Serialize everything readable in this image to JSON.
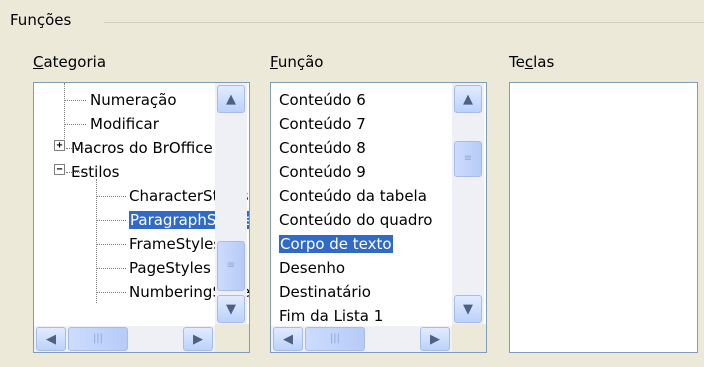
{
  "group": {
    "title": "Funções"
  },
  "columns": {
    "category": {
      "label_mnemonic": "C",
      "label_rest": "ategoria"
    },
    "function": {
      "label_mnemonic": "F",
      "label_rest": "unção"
    },
    "keys": {
      "label_pre": "Te",
      "label_mnemonic": "c",
      "label_rest": "las"
    }
  },
  "category_tree": [
    {
      "label": "Numeração",
      "level": 1
    },
    {
      "label": "Modificar",
      "level": 1
    },
    {
      "label": "Macros do BrOffice",
      "level": 0,
      "expander": "+"
    },
    {
      "label": "Estilos",
      "level": 0,
      "expander": "−"
    },
    {
      "label": "CharacterStyles",
      "level": 1
    },
    {
      "label": "ParagraphStyles",
      "level": 1,
      "selected": true
    },
    {
      "label": "FrameStyles",
      "level": 1
    },
    {
      "label": "PageStyles",
      "level": 1
    },
    {
      "label": "NumberingStyles",
      "level": 1
    }
  ],
  "function_list": [
    {
      "label": "Conteúdo 6"
    },
    {
      "label": "Conteúdo 7"
    },
    {
      "label": "Conteúdo 8"
    },
    {
      "label": "Conteúdo 9"
    },
    {
      "label": "Conteúdo da tabela"
    },
    {
      "label": "Conteúdo do quadro"
    },
    {
      "label": "Corpo de texto",
      "selected": true
    },
    {
      "label": "Desenho"
    },
    {
      "label": "Destinatário"
    },
    {
      "label": "Fim da Lista 1"
    }
  ],
  "keys_list": [],
  "icons": {
    "up": "▲",
    "down": "▼",
    "left": "◀",
    "right": "▶",
    "plus": "+",
    "minus": "−",
    "grip": "≡",
    "hgrip": "|||"
  },
  "colors": {
    "selection": "#316ac5",
    "border": "#7f9db9",
    "background": "#ece9d8"
  }
}
